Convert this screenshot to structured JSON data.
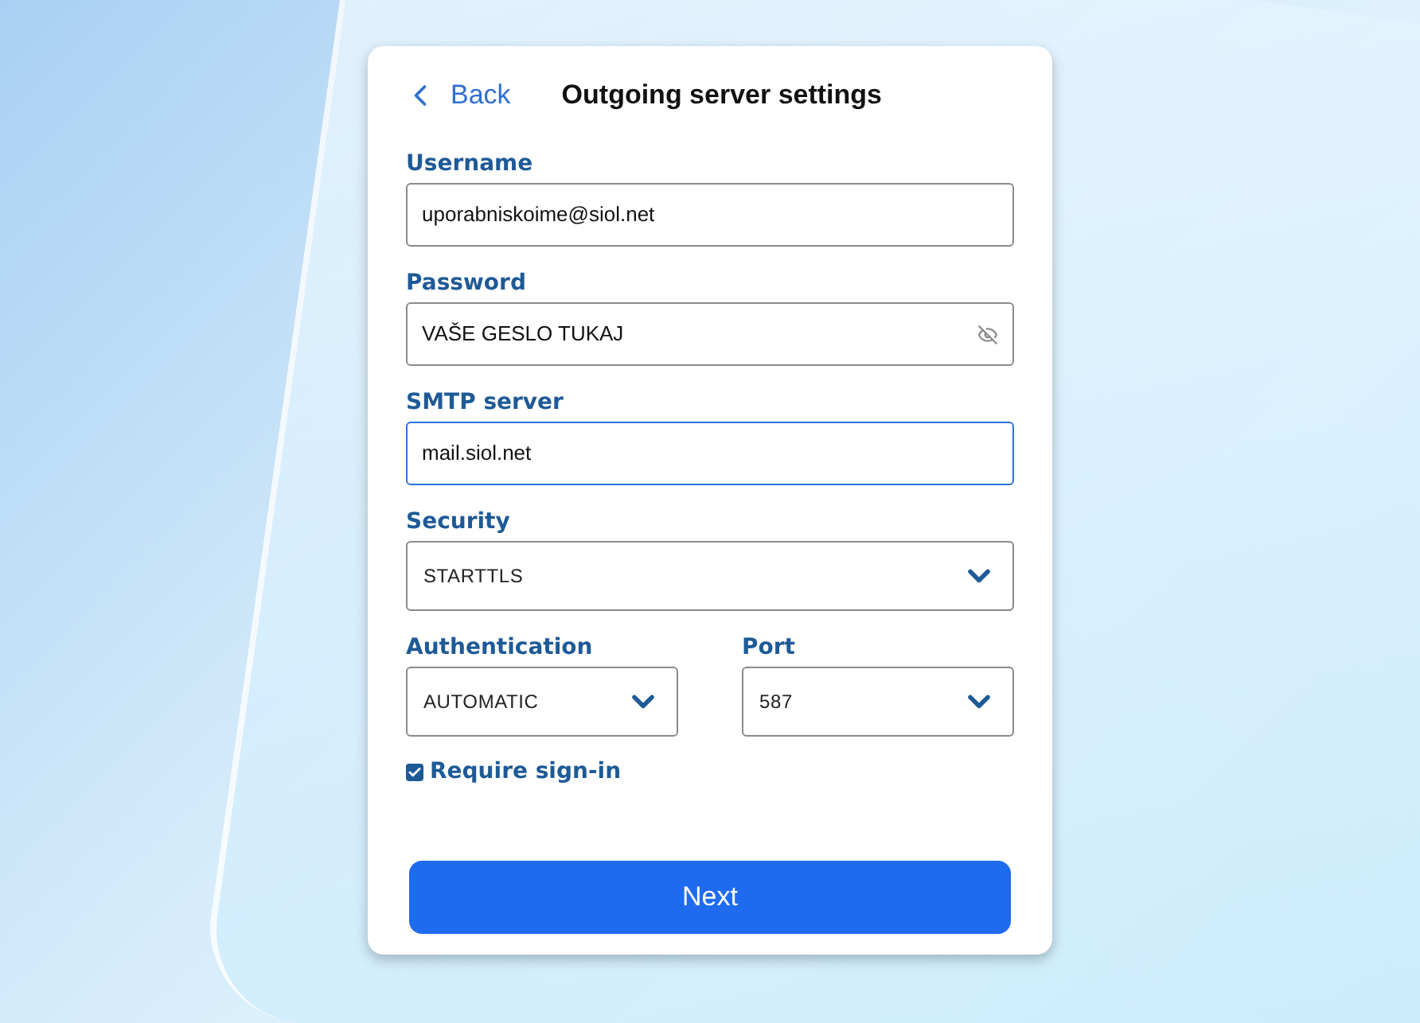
{
  "header": {
    "back_label": "Back",
    "title": "Outgoing server settings"
  },
  "text_fields": [
    {
      "label": "Username",
      "value": "uporabniskoime@siol.net",
      "focused": false,
      "kind": "plain"
    },
    {
      "label": "Password",
      "value": "VAŠE GESLO TUKAJ",
      "focused": false,
      "kind": "password"
    },
    {
      "label": "SMTP server",
      "value": "mail.siol.net",
      "focused": true,
      "kind": "plain"
    }
  ],
  "security": {
    "label": "Security",
    "value": "STARTTLS"
  },
  "authentication": {
    "label": "Authentication",
    "value": "AUTOMATIC"
  },
  "port": {
    "label": "Port",
    "value": "587"
  },
  "require_sign_in": {
    "label": "Require sign-in",
    "checked": true
  },
  "next_button": "Next"
}
